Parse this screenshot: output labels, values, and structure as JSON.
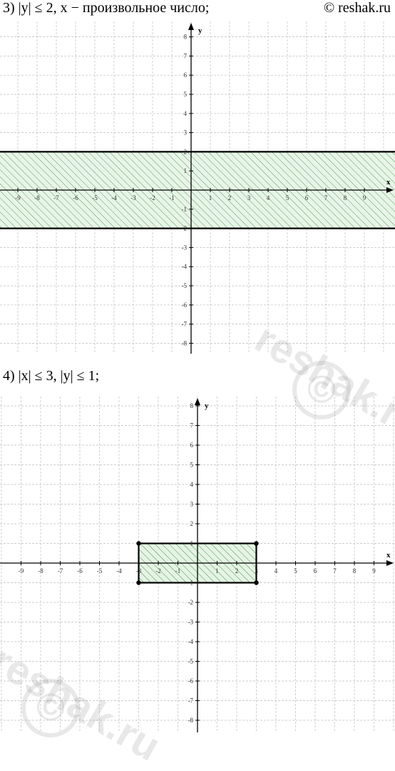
{
  "header": {
    "problem3": "3) |y| ≤ 2, x − произвольное число;",
    "problem4": "4) |x| ≤ 3, |y| ≤ 1;",
    "copyright": "© reshak.ru"
  },
  "watermark": {
    "text": "reshak.ru",
    "symbol": "©"
  },
  "colors": {
    "hatch": "#3a9a3a",
    "grid": "#bdbdbd",
    "axis": "#000000",
    "fill": "#e6f3e6"
  },
  "chart_data": [
    {
      "type": "region",
      "xlabel": "x",
      "ylabel": "y",
      "xlim": [
        -9,
        9
      ],
      "ylim": [
        -8,
        8
      ],
      "xticks": [
        -9,
        -8,
        -7,
        -6,
        -5,
        -4,
        -3,
        -2,
        -1,
        1,
        2,
        3,
        4,
        5,
        6,
        7,
        8,
        9
      ],
      "yticks": [
        -8,
        -7,
        -6,
        -5,
        -4,
        -3,
        -2,
        -1,
        1,
        2,
        3,
        4,
        5,
        6,
        7,
        8
      ],
      "grid": true,
      "region": {
        "shape": "band",
        "y_min": -2,
        "y_max": 2,
        "x": "any",
        "pattern": "hatched"
      }
    },
    {
      "type": "region",
      "xlabel": "x",
      "ylabel": "y",
      "xlim": [
        -9,
        9
      ],
      "ylim": [
        -8,
        8
      ],
      "xticks": [
        -9,
        -8,
        -7,
        -6,
        -5,
        -4,
        -3,
        -2,
        -1,
        1,
        2,
        3,
        4,
        5,
        6,
        7,
        8,
        9
      ],
      "yticks": [
        -8,
        -7,
        -6,
        -5,
        -4,
        -3,
        -2,
        -1,
        1,
        2,
        3,
        4,
        5,
        6,
        7,
        8
      ],
      "grid": true,
      "region": {
        "shape": "rectangle",
        "x_min": -3,
        "x_max": 3,
        "y_min": -1,
        "y_max": 1,
        "pattern": "hatched",
        "vertices": [
          [
            -3,
            1
          ],
          [
            3,
            1
          ],
          [
            3,
            -1
          ],
          [
            -3,
            -1
          ]
        ]
      }
    }
  ]
}
